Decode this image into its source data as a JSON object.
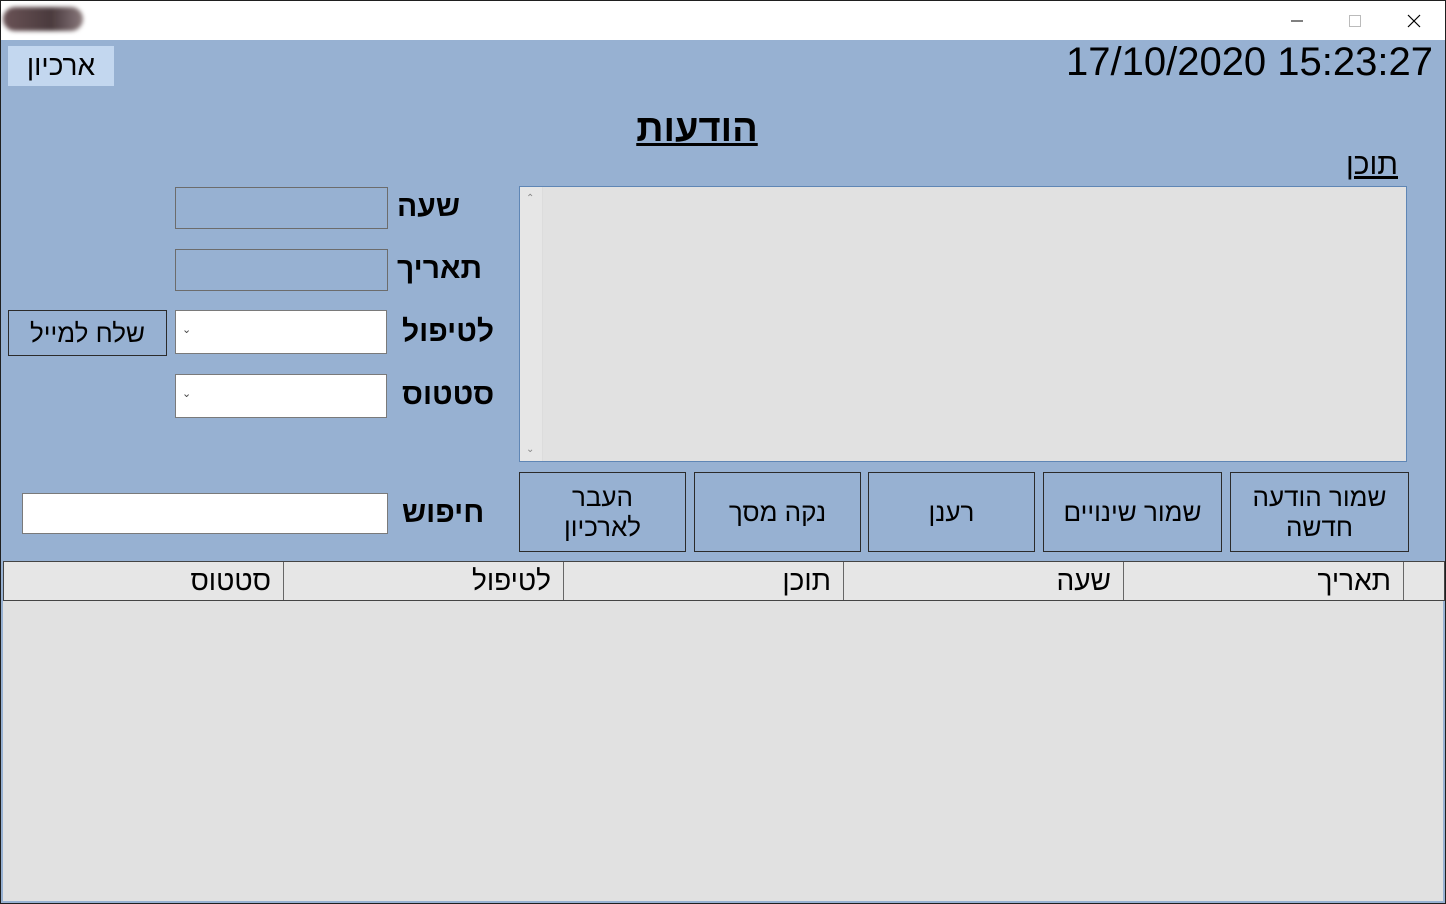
{
  "titlebar": {
    "minimize_glyph": "–",
    "maximize_glyph": "□",
    "close_glyph": "✕"
  },
  "header": {
    "archive_label": "ארכיון",
    "datetime": "17/10/2020 15:23:27",
    "title": "הודעות"
  },
  "content": {
    "label": "תוכן",
    "value": ""
  },
  "form": {
    "time_label": "שעה",
    "date_label": "תאריך",
    "handling_label": "לטיפול",
    "status_label": "סטטוס",
    "search_label": "חיפוש",
    "time_value": "",
    "date_value": "",
    "handling_value": "",
    "status_value": "",
    "search_value": "",
    "send_mail_label": "שלח למייל"
  },
  "actions": {
    "save_new": "שמור הודעה\nחדשה",
    "save_changes": "שמור שינויים",
    "refresh": "רענן",
    "clear_screen": "נקה מסך",
    "move_to_archive": "העבר\nלארכיון"
  },
  "grid": {
    "columns": [
      "תאריך",
      "שעה",
      "תוכן",
      "לטיפול",
      "סטטוס"
    ],
    "rows": []
  },
  "colors": {
    "background": "#97b1d2",
    "archive_button": "#c3d7ef",
    "grid_background": "#e1e1e1"
  }
}
